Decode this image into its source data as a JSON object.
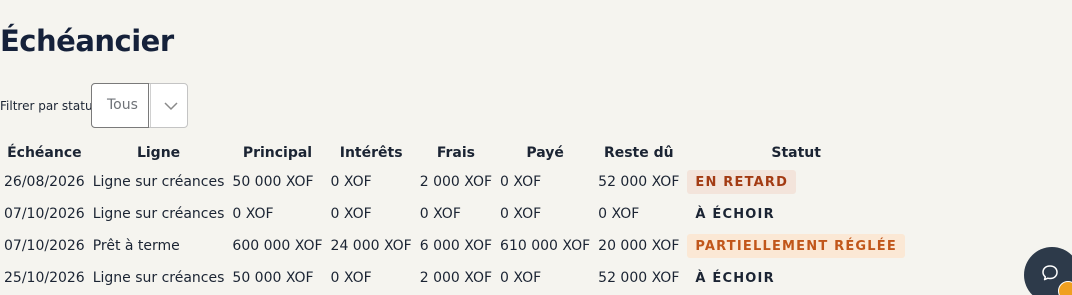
{
  "page": {
    "title": "Échéancier"
  },
  "filter": {
    "label": "Filtrer par statut",
    "value": "Tous"
  },
  "table": {
    "headers": {
      "date": "Échéance",
      "ligne": "Ligne",
      "principal": "Principal",
      "interets": "Intérêts",
      "frais": "Frais",
      "paye": "Payé",
      "reste": "Reste dû",
      "statut": "Statut"
    },
    "rows": [
      {
        "date": "26/08/2026",
        "ligne": "Ligne sur créances",
        "principal": "50 000 XOF",
        "interets": "0 XOF",
        "frais": "2 000 XOF",
        "paye": "0 XOF",
        "reste": "52 000 XOF",
        "statut": "EN RETARD"
      },
      {
        "date": "07/10/2026",
        "ligne": "Ligne sur créances",
        "principal": "0 XOF",
        "interets": "0 XOF",
        "frais": "0 XOF",
        "paye": "0 XOF",
        "reste": "0 XOF",
        "statut": "À ÉCHOIR"
      },
      {
        "date": "07/10/2026",
        "ligne": "Prêt à terme",
        "principal": "600 000 XOF",
        "interets": "24 000 XOF",
        "frais": "6 000 XOF",
        "paye": "610 000 XOF",
        "reste": "20 000 XOF",
        "statut": "PARTIELLEMENT RÉGLÉE"
      },
      {
        "date": "25/10/2026",
        "ligne": "Ligne sur créances",
        "principal": "50 000 XOF",
        "interets": "0 XOF",
        "frais": "2 000 XOF",
        "paye": "0 XOF",
        "reste": "52 000 XOF",
        "statut": "À ÉCHOIR"
      }
    ]
  },
  "colors": {
    "status_late_bg": "#f3e4db",
    "status_late_text": "#a33b13",
    "status_partial_bg": "#fbe8d5",
    "status_partial_text": "#c1561a",
    "chat_button_bg": "#2d3a4a"
  },
  "icons": {
    "select": "chevron-down-icon",
    "chat": "chat-bubble-icon",
    "chat_badge": "lock-icon"
  }
}
